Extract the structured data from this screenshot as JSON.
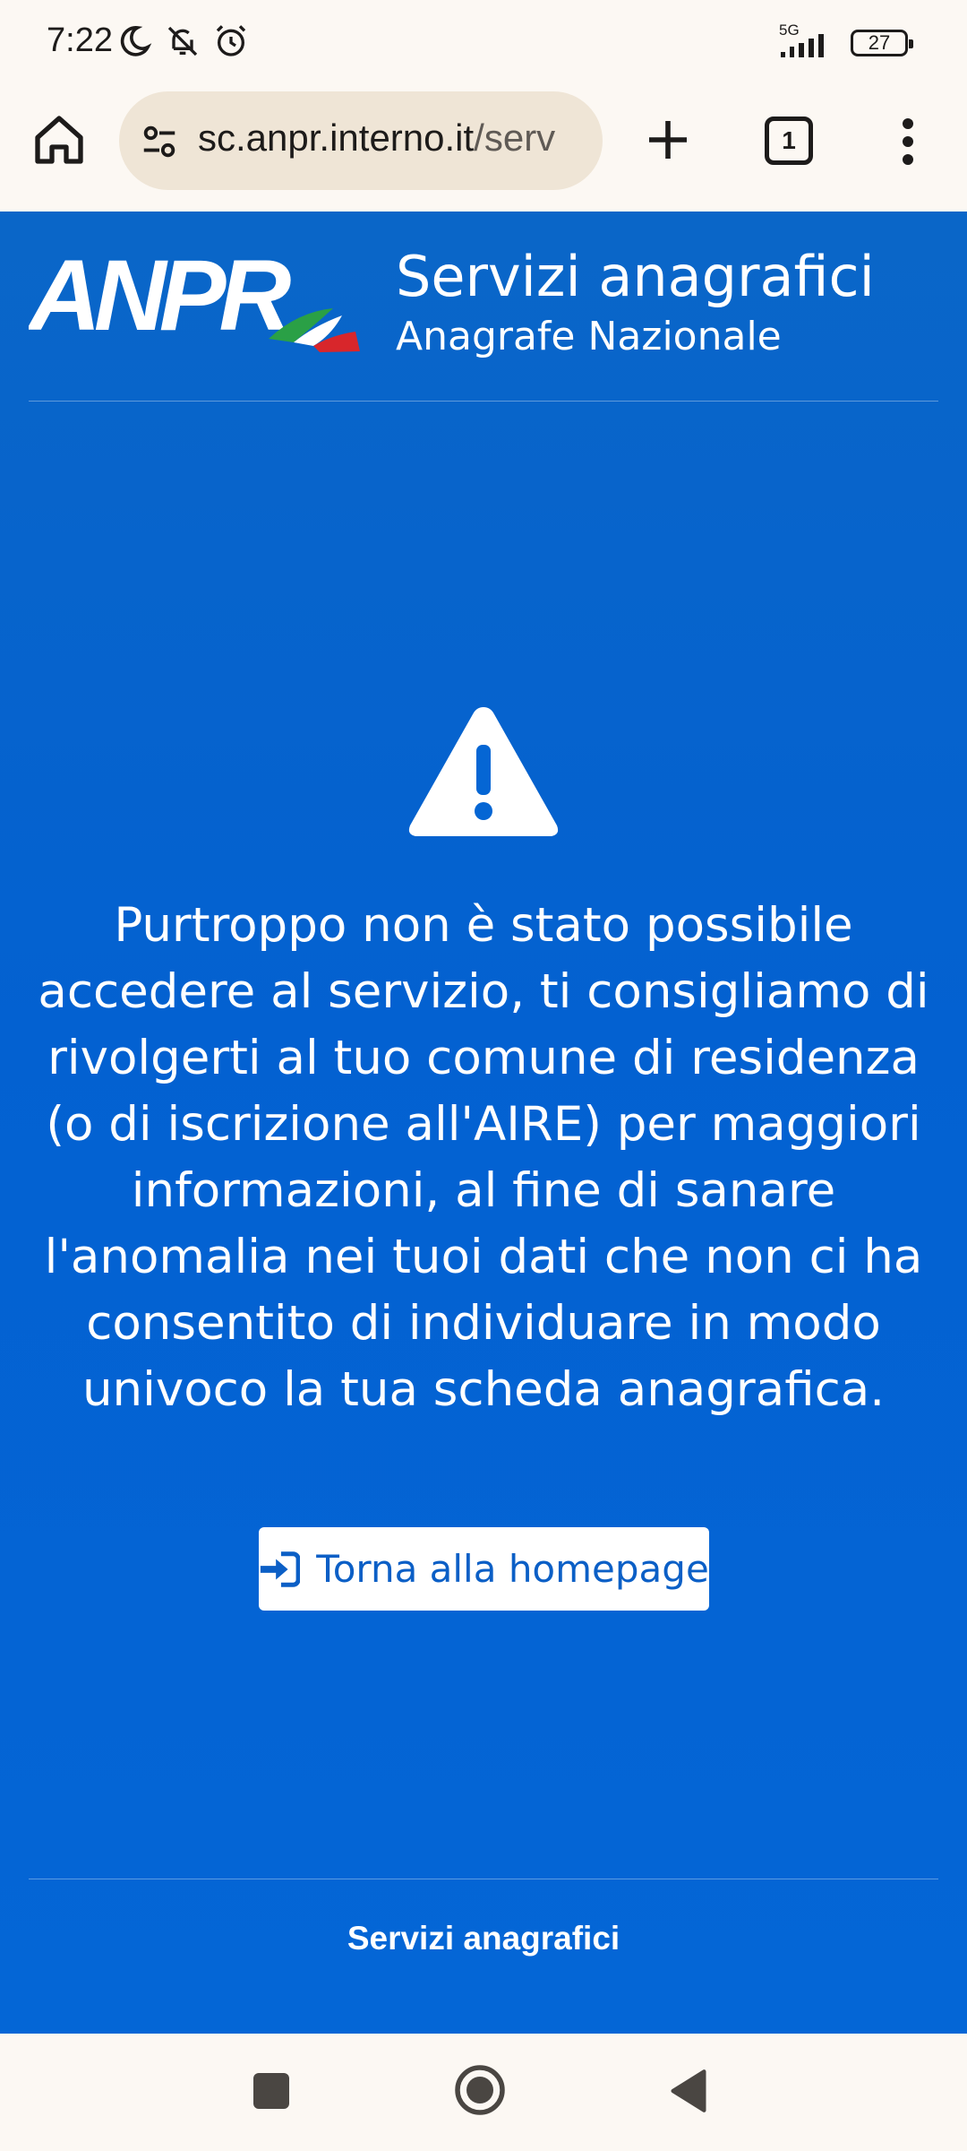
{
  "status_bar": {
    "time": "7:22",
    "network": "5G",
    "battery": "27",
    "icons": [
      "moon-icon",
      "bell-off-icon",
      "alarm-icon",
      "signal-icon",
      "battery-icon"
    ]
  },
  "browser": {
    "url_host": "sc.anpr.interno.it",
    "url_path": "/serv",
    "tab_count": "1",
    "icons": [
      "home-icon",
      "site-settings-icon",
      "plus-icon",
      "tabs-icon",
      "more-vert-icon"
    ]
  },
  "header": {
    "logo_text": "ANPR",
    "title": "Servizi anagrafici",
    "subtitle": "Anagrafe Nazionale"
  },
  "main": {
    "message": "Purtroppo non è stato possibile accedere al servizio, ti consigliamo di rivolgerti al tuo comune di residenza (o di iscrizione all'AIRE) per maggiori informazioni, al fine di sanare l'anomalia nei tuoi dati che non ci ha consentito di individuare in modo univoco la tua scheda anagrafica.",
    "button_label": "Torna alla homepage"
  },
  "footer": {
    "text": "Servizi anagrafici"
  },
  "colors": {
    "page_blue": "#0566d4",
    "button_text": "#0b5fc6",
    "flag_green": "#2aa046",
    "flag_red": "#d8262b"
  }
}
